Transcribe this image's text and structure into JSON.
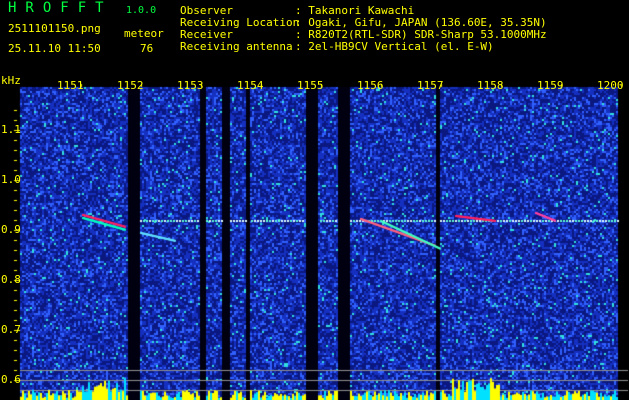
{
  "header": {
    "app_title": "HROFFT",
    "version": "1.0.0",
    "file_name": "2511101150.png",
    "datetime": "25.11.10 11:50",
    "meteor_label": "meteor",
    "meteor_count": "76",
    "info": [
      {
        "label": "Observer",
        "value": "Takanori Kawachi"
      },
      {
        "label": "Receiving Location",
        "value": "Ogaki, Gifu, JAPAN (136.60E, 35.35N)"
      },
      {
        "label": "Receiver",
        "value": "R820T2(RTL-SDR) SDR-Sharp 53.1000MHz"
      },
      {
        "label": "Receiving antenna",
        "value": "2el-HB9CV Vertical (el. E-W)"
      }
    ]
  },
  "chart_data": {
    "type": "heatmap",
    "ylabel": "kHz",
    "x_ticks": [
      "1151",
      "1152",
      "1153",
      "1154",
      "1155",
      "1156",
      "1157",
      "1158",
      "1159",
      "1200"
    ],
    "y_ticks": [
      "1.1",
      "1.0",
      "0.9",
      "0.8",
      "0.7",
      "0.6"
    ],
    "ylim": [
      0.57,
      1.19
    ],
    "reference_lines_khz": [
      0.62,
      0.6,
      0.58
    ],
    "carrier_khz": 0.92,
    "colors": {
      "background": "#0a1a9a",
      "noise": "#3060ff",
      "signal": "#00ffc0",
      "peak": "#ff2060",
      "histogram": "#ffff00",
      "histogram_low": "#00e0ff"
    }
  }
}
